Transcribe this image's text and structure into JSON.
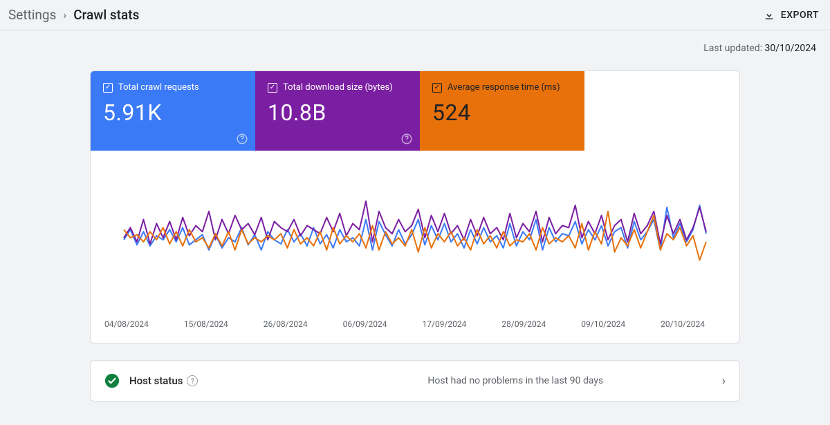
{
  "breadcrumb": {
    "settings": "Settings",
    "current": "Crawl stats"
  },
  "export_label": "EXPORT",
  "last_updated_prefix": "Last updated: ",
  "last_updated_date": "30/10/2024",
  "metrics": {
    "requests": {
      "label": "Total crawl requests",
      "value": "5.91K",
      "color": "#3b7af7"
    },
    "download": {
      "label": "Total download size (bytes)",
      "value": "10.8B",
      "color": "#7b1fa2"
    },
    "response": {
      "label": "Average response time (ms)",
      "value": "524",
      "color": "#e8710a"
    }
  },
  "host_status": {
    "title": "Host status",
    "message": "Host had no problems in the last 90 days"
  },
  "chart_data": {
    "type": "line",
    "xlabel": "",
    "ylabel": "",
    "x_ticks": [
      "04/08/2024",
      "15/08/2024",
      "26/08/2024",
      "06/09/2024",
      "17/09/2024",
      "28/09/2024",
      "09/10/2024",
      "20/10/2024"
    ],
    "x_range_days": 90,
    "ylim": [
      0,
      100
    ],
    "note": "Y-axis has no visible ticks; values below are relative estimates (0-100 scale) read from the chart shape.",
    "series": [
      {
        "name": "Total crawl requests",
        "color": "#3b7af7",
        "values": [
          50,
          60,
          45,
          58,
          44,
          54,
          50,
          60,
          48,
          62,
          45,
          50,
          55,
          40,
          55,
          42,
          52,
          48,
          62,
          45,
          55,
          40,
          58,
          50,
          46,
          60,
          48,
          56,
          44,
          62,
          46,
          55,
          42,
          60,
          48,
          52,
          44,
          70,
          40,
          68,
          55,
          44,
          60,
          46,
          55,
          70,
          45,
          64,
          50,
          66,
          48,
          56,
          42,
          60,
          46,
          62,
          48,
          54,
          42,
          66,
          44,
          58,
          50,
          70,
          40,
          62,
          48,
          56,
          54,
          68,
          46,
          60,
          50,
          64,
          44,
          58,
          62,
          42,
          68,
          50,
          58,
          70,
          40,
          82,
          52,
          66,
          48,
          60,
          84,
          56
        ]
      },
      {
        "name": "Total download size (bytes)",
        "color": "#7b1fa2",
        "values": [
          52,
          62,
          48,
          70,
          46,
          66,
          52,
          68,
          50,
          72,
          54,
          64,
          58,
          78,
          50,
          70,
          56,
          74,
          60,
          66,
          55,
          72,
          50,
          68,
          62,
          58,
          70,
          54,
          64,
          60,
          56,
          72,
          58,
          76,
          54,
          66,
          60,
          88,
          48,
          78,
          62,
          56,
          70,
          58,
          64,
          80,
          52,
          74,
          58,
          76,
          56,
          64,
          50,
          70,
          54,
          72,
          56,
          62,
          50,
          76,
          52,
          66,
          58,
          78,
          48,
          72,
          56,
          64,
          62,
          84,
          52,
          68,
          56,
          74,
          50,
          64,
          70,
          48,
          76,
          56,
          64,
          78,
          46,
          74,
          56,
          70,
          50,
          62,
          82,
          58
        ]
      },
      {
        "name": "Average response time (ms)",
        "color": "#e8710a",
        "values": [
          60,
          52,
          55,
          48,
          58,
          50,
          62,
          46,
          58,
          44,
          60,
          48,
          52,
          42,
          56,
          44,
          58,
          40,
          60,
          46,
          52,
          48,
          54,
          50,
          56,
          42,
          60,
          46,
          52,
          44,
          58,
          40,
          62,
          46,
          54,
          48,
          56,
          42,
          64,
          40,
          58,
          46,
          52,
          44,
          60,
          38,
          62,
          42,
          56,
          48,
          58,
          44,
          52,
          40,
          60,
          46,
          54,
          42,
          58,
          44,
          50,
          48,
          56,
          40,
          62,
          46,
          52,
          48,
          54,
          42,
          66,
          40,
          58,
          46,
          78,
          38,
          52,
          44,
          60,
          42,
          58,
          74,
          40,
          56,
          50,
          62,
          44,
          54,
          30,
          48
        ]
      }
    ]
  }
}
